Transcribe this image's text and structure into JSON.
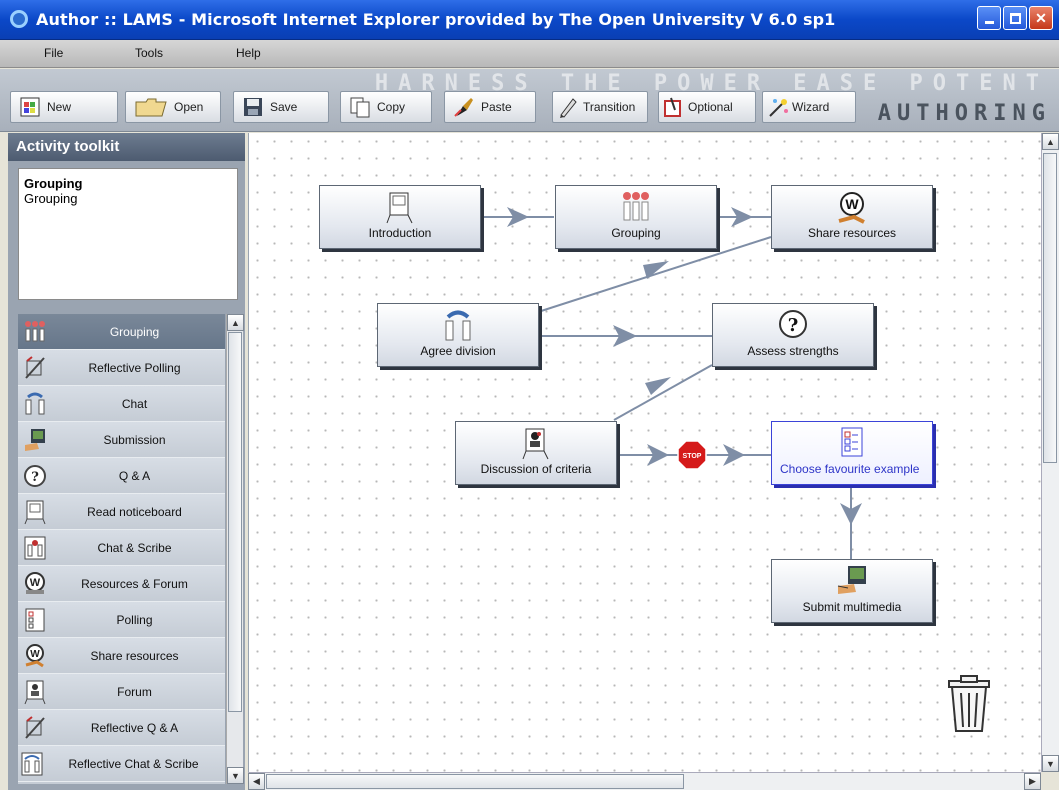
{
  "window": {
    "title": "Author :: LAMS - Microsoft Internet Explorer provided by The Open University V 6.0 sp1"
  },
  "menu": [
    "File",
    "Tools",
    "Help"
  ],
  "toolbar": {
    "buttons": [
      "New",
      "Open",
      "Save",
      "Copy",
      "Paste",
      "Transition",
      "Optional",
      "Wizard"
    ],
    "watermark_top": "HARNESS THE POWER EASE POTENT",
    "watermark_bottom": "AUTHORING"
  },
  "toolkit": {
    "title": "Activity toolkit",
    "info_title": "Grouping",
    "info_desc": "Grouping",
    "tools": [
      "Grouping",
      "Reflective Polling",
      "Chat",
      "Submission",
      "Q & A",
      "Read noticeboard",
      "Chat & Scribe",
      "Resources & Forum",
      "Polling",
      "Share resources",
      "Forum",
      "Reflective Q & A",
      "Reflective Chat & Scribe"
    ],
    "selected_tool": "Grouping"
  },
  "activities": [
    "Introduction",
    "Grouping",
    "Share resources",
    "Agree division",
    "Assess strengths",
    "Discussion of criteria",
    "Choose favourite example",
    "Submit multimedia"
  ],
  "stop_label": "STOP",
  "colors": {
    "title_bar": "#0b48c8",
    "canvas": "#ffffff",
    "arrow": "#7f8ea6",
    "selected_node": "#3b43d8",
    "stop_sign": "#d51a1a"
  },
  "icons": {
    "new": "new-document-icon",
    "open": "folder-icon",
    "save": "floppy-disk-icon",
    "copy": "copy-icon",
    "paste": "brush-icon",
    "transition": "pen-icon",
    "optional": "optional-icon",
    "wizard": "wizard-wand-icon",
    "trash": "trash-can-icon"
  }
}
